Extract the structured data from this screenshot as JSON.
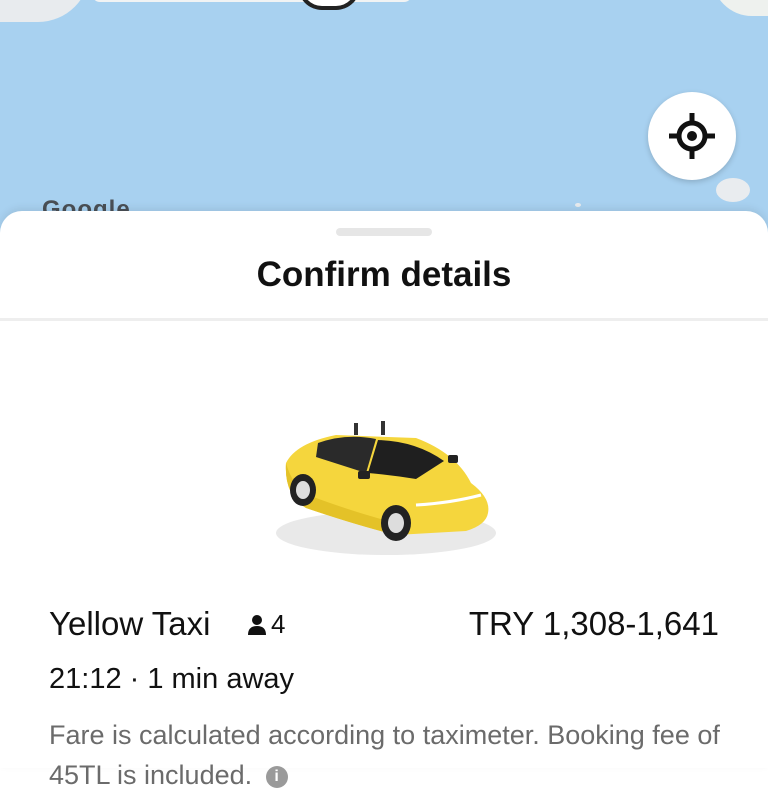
{
  "map": {
    "attribution": "Google",
    "locate_icon": "crosshair-icon"
  },
  "sheet": {
    "title": "Confirm details"
  },
  "ride": {
    "name": "Yellow Taxi",
    "seats_icon": "person-icon",
    "seats": "4",
    "price": "TRY 1,308-1,641",
    "eta": "21:12 · 1 min away",
    "note": "Fare is calculated according to taximeter. Booking fee of 45TL is included.",
    "info_icon": "info-icon"
  },
  "colors": {
    "map_water": "#a8d1f0",
    "taxi_yellow": "#f5d63d",
    "text_primary": "#111111",
    "text_secondary": "#6b6b6b"
  }
}
